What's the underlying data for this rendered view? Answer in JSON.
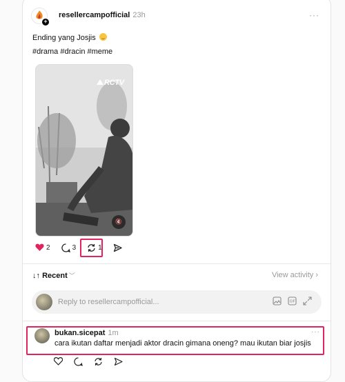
{
  "post": {
    "username": "resellercampofficial",
    "time": "23h",
    "caption": "Ending yang Josjis",
    "hashtags": "#drama #dracin #meme",
    "video_logo": "RCTV",
    "likes": "2",
    "comments": "3",
    "reposts": "1"
  },
  "thread": {
    "sort_label": "Recent",
    "view_activity": "View activity"
  },
  "reply": {
    "placeholder": "Reply to resellercampofficial..."
  },
  "comment": {
    "username": "bukan.sicepat",
    "time": "1m",
    "text": "cara ikutan daftar menjadi aktor dracin gimana oneng? mau ikutan biar josjis"
  },
  "colors": {
    "like": "#e0245e",
    "highlight": "#e0245e",
    "muted_text": "#999999"
  }
}
